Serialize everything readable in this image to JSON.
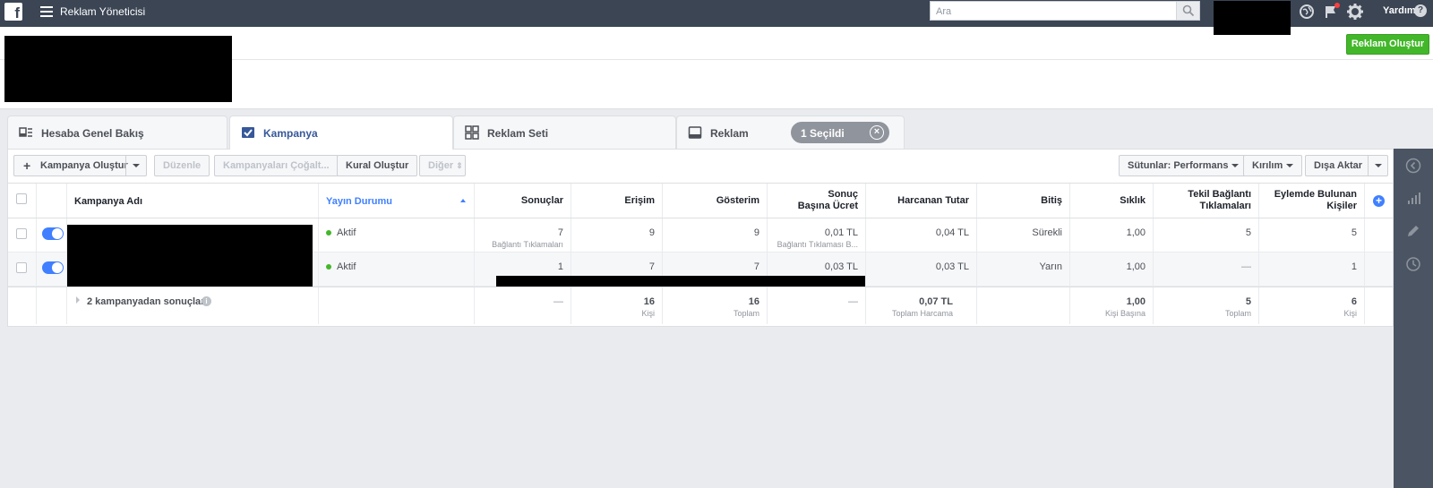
{
  "topbar": {
    "logo": "f",
    "app_title": "Reklam Yöneticisi",
    "search_placeholder": "Ara",
    "help_label": "Yardım",
    "help_glyph": "?"
  },
  "header": {
    "create_ad_label": "Reklam Oluştur"
  },
  "tabs": [
    {
      "label": "Hesaba Genel Bakış",
      "icon": "overview-icon"
    },
    {
      "label": "Kampanya",
      "icon": "checkbox-checked-icon"
    },
    {
      "label": "Reklam Seti",
      "icon": "grid-icon"
    },
    {
      "label": "Reklam",
      "icon": "ad-icon"
    }
  ],
  "selection": {
    "label": "1 Seçildi",
    "close_glyph": "×"
  },
  "toolbar": {
    "create_campaign": "Kampanya Oluştur",
    "create_glyph": "+",
    "edit": "Düzenle",
    "duplicate": "Kampanyaları Çoğalt...",
    "create_rule": "Kural Oluştur",
    "other": "Diğer",
    "other_glyph": "⇕",
    "columns": "Sütunlar: Performans",
    "breakdown": "Kırılım",
    "export": "Dışa Aktar"
  },
  "table": {
    "columns": [
      "Kampanya Adı",
      "Yayın Durumu",
      "Sonuçlar",
      "Erişim",
      "Gösterim",
      "Sonuç Başına Ücret",
      "Harcanan Tutar",
      "Bitiş",
      "Sıklık",
      "Tekil Bağlantı Tıklamaları",
      "Eylemde Bulunan Kişiler"
    ],
    "rows": [
      {
        "status": "Aktif",
        "results": "7",
        "results_sub": "Bağlantı Tıklamaları",
        "reach": "9",
        "impressions": "9",
        "cost_per_result": "0,01 TL",
        "cost_per_result_sub": "Bağlantı Tıklaması B...",
        "spent": "0,04 TL",
        "ends": "Sürekli",
        "frequency": "1,00",
        "unique_clicks": "5",
        "people_taking_action": "5"
      },
      {
        "status": "Aktif",
        "results": "1",
        "results_sub": "",
        "reach": "7",
        "impressions": "7",
        "cost_per_result": "0,03 TL",
        "cost_per_result_sub": "",
        "spent": "0,03 TL",
        "ends": "Yarın",
        "frequency": "1,00",
        "unique_clicks": "—",
        "people_taking_action": "1"
      }
    ],
    "summary": {
      "label": "2 kampanyadan sonuçlar",
      "info_glyph": "i",
      "results": "—",
      "reach": "16",
      "reach_sub": "Kişi",
      "impressions": "16",
      "impressions_sub": "Toplam",
      "cost_per_result": "—",
      "spent": "0,07 TL",
      "spent_sub": "Toplam Harcama",
      "frequency": "1,00",
      "frequency_sub": "Kişi Başına",
      "unique_clicks": "5",
      "unique_clicks_sub": "Toplam",
      "people_taking_action": "6",
      "people_taking_action_sub": "Kişi"
    }
  },
  "colors": {
    "topbar": "#3b4554",
    "accent": "#4080ff",
    "green": "#42b72a",
    "link": "#365899"
  }
}
